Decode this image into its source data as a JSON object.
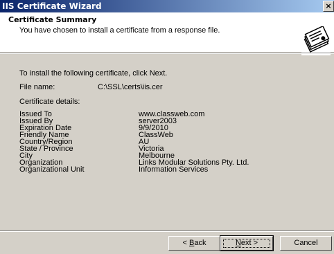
{
  "window": {
    "title": "IIS Certificate Wizard",
    "close_glyph": "×"
  },
  "header": {
    "title": "Certificate Summary",
    "subtitle": "You have chosen to install a certificate from a response file.",
    "icon": "certificate-wizard-icon"
  },
  "body": {
    "instruction": "To install the following certificate, click Next.",
    "file_label": "File name:",
    "file_value": "C:\\SSL\\certs\\iis.cer",
    "details_label": "Certificate details:",
    "details": [
      {
        "label": "Issued To",
        "value": "www.classweb.com"
      },
      {
        "label": "Issued By",
        "value": "server2003"
      },
      {
        "label": "Expiration Date",
        "value": "9/9/2010"
      },
      {
        "label": "Friendly Name",
        "value": "ClassWeb"
      },
      {
        "label": "Country/Region",
        "value": "AU"
      },
      {
        "label": "State / Province",
        "value": "Victoria"
      },
      {
        "label": "City",
        "value": "Melbourne"
      },
      {
        "label": "Organization",
        "value": "Links Modular Solutions Pty. Ltd."
      },
      {
        "label": "Organizational Unit",
        "value": "Information Services"
      }
    ]
  },
  "buttons": {
    "back": {
      "prefix": "< ",
      "mnemonic": "B",
      "rest": "ack"
    },
    "next": {
      "mnemonic": "N",
      "rest": "ext >"
    },
    "cancel": "Cancel"
  }
}
